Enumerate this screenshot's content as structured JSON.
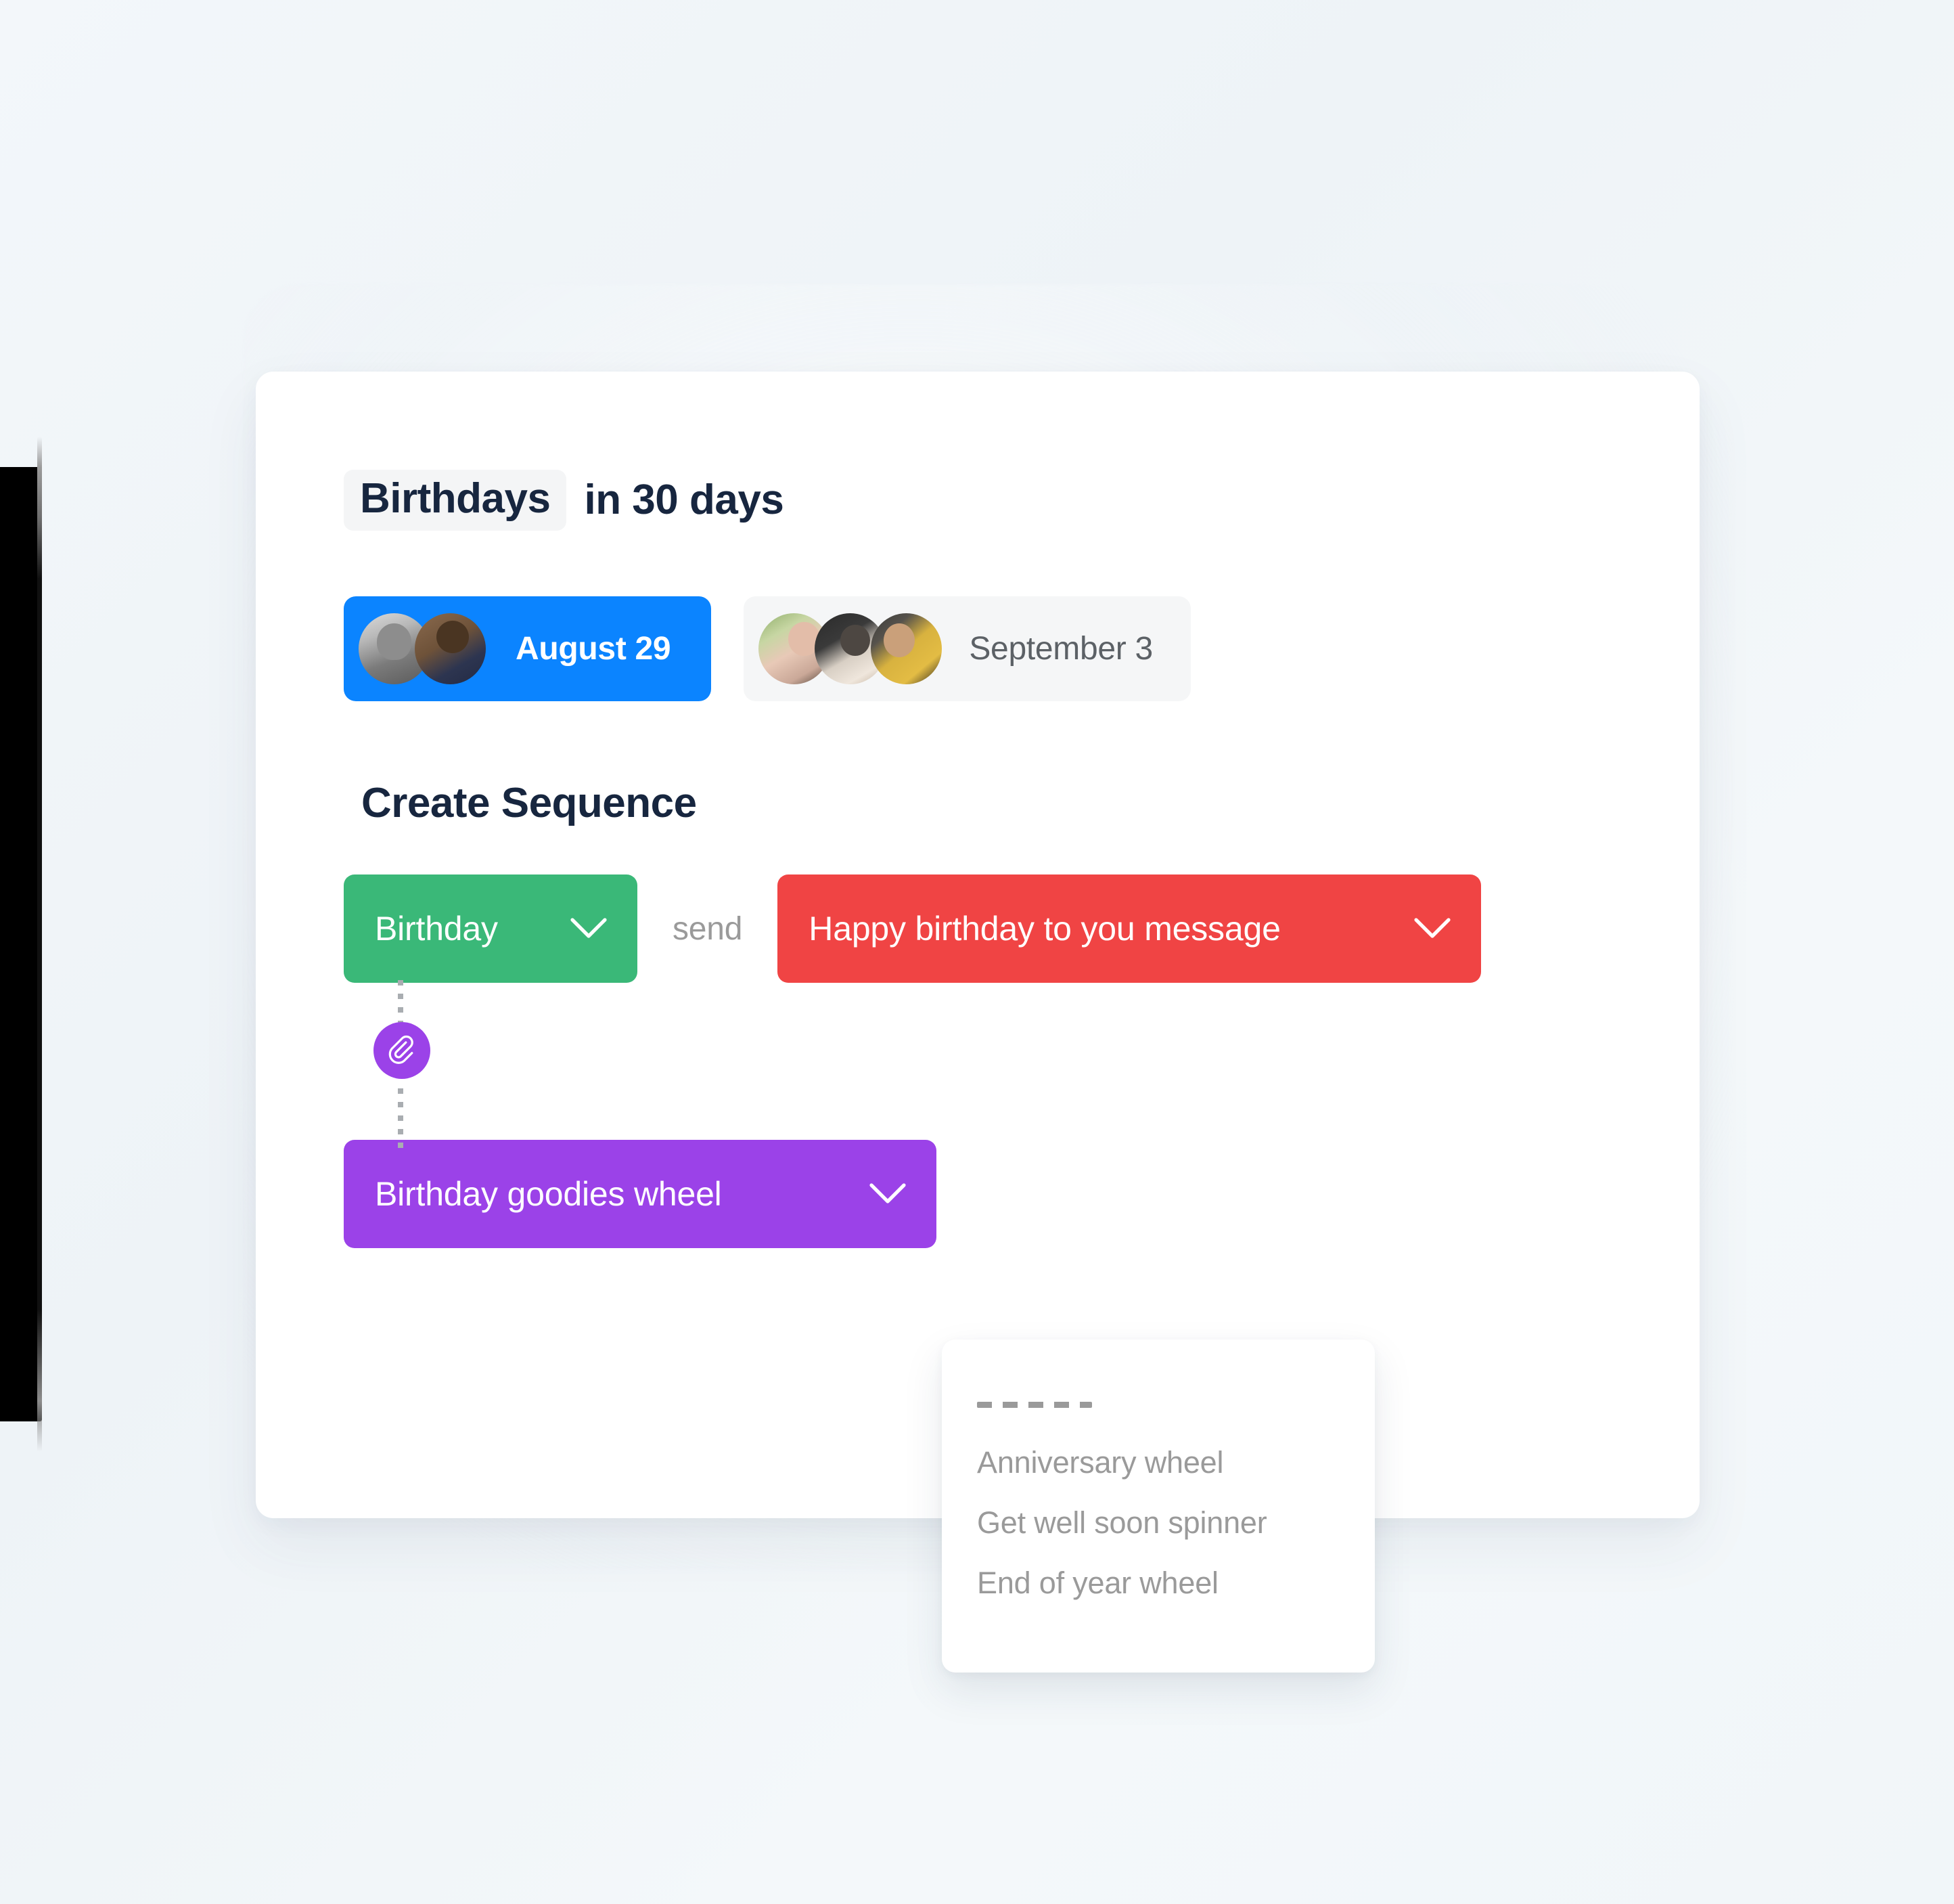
{
  "header": {
    "title_highlight": "Birthdays",
    "title_rest": "in 30 days"
  },
  "date_chips": [
    {
      "label": "August 29",
      "selected": true,
      "avatar_count": 2,
      "bg_color": "#0b84ff",
      "text_color": "#ffffff"
    },
    {
      "label": "September 3",
      "selected": false,
      "avatar_count": 3,
      "bg_color": "#f5f6f7",
      "text_color": "#5c6166"
    }
  ],
  "sequence": {
    "heading": "Create Sequence",
    "trigger": {
      "label": "Birthday",
      "color": "#3ab878",
      "chevron_icon": "chevron-down-icon"
    },
    "connector_word": "send",
    "action": {
      "label": "Happy birthday to you message",
      "color": "#f04444",
      "chevron_icon": "chevron-down-icon"
    },
    "attachment_node": {
      "icon": "paperclip-icon",
      "color": "#9b42e8"
    },
    "attachment": {
      "label": "Birthday goodies wheel",
      "color": "#9b42e8",
      "chevron_icon": "chevron-down-icon"
    }
  },
  "wheel_menu": {
    "separator": "------",
    "items": [
      {
        "label": "Anniversary wheel"
      },
      {
        "label": "Get well soon spinner"
      },
      {
        "label": "End of year wheel"
      }
    ]
  },
  "colors": {
    "page_background": "#f2f7fa",
    "card_background": "#ffffff",
    "title_text": "#17263f",
    "muted_text": "#9a9a9a",
    "accent_blue": "#0b84ff",
    "accent_green": "#3ab878",
    "accent_red": "#f04444",
    "accent_purple": "#9b42e8",
    "device_bezel": "#000000"
  }
}
